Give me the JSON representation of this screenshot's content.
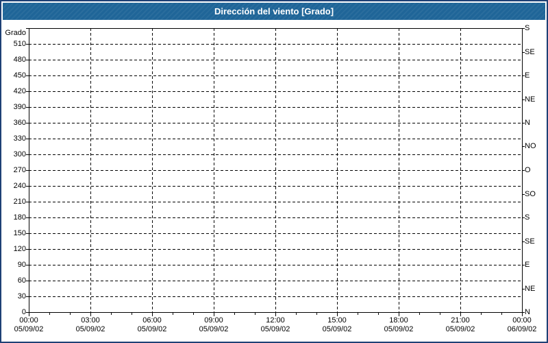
{
  "title": "Dirección del viento [Grado]",
  "colors": {
    "titlebar": "#1f6598",
    "outer_border": "#1e4175",
    "grid_line": "#000000",
    "background": "#ffffff",
    "title_text": "#ffffff",
    "label_text": "#000000"
  },
  "chart_data": {
    "type": "line",
    "title": "Dirección del viento [Grado]",
    "grid": {
      "horizontal": "dashed",
      "vertical": "dashed"
    },
    "legend": "none",
    "series": [],
    "y_axis_left": {
      "label": "Grado",
      "min": 0,
      "max": 540,
      "tick_step": 30,
      "tick_labels": [
        "0",
        "30",
        "60",
        "90",
        "120",
        "150",
        "180",
        "210",
        "240",
        "270",
        "300",
        "330",
        "360",
        "390",
        "420",
        "450",
        "480",
        "510"
      ]
    },
    "y_axis_right": {
      "tick_step": 45,
      "tick_labels_top_to_bottom": [
        "S",
        "SE",
        "E",
        "NE",
        "N",
        "NO",
        "O",
        "SO",
        "S",
        "SE",
        "E",
        "NE",
        "N"
      ]
    },
    "x_axis": {
      "minor_ticks_per_major_interval": 2,
      "major_ticks": [
        {
          "time": "00:00",
          "date": "05/09/02"
        },
        {
          "time": "03:00",
          "date": "05/09/02"
        },
        {
          "time": "06:00",
          "date": "05/09/02"
        },
        {
          "time": "09:00",
          "date": "05/09/02"
        },
        {
          "time": "12:00",
          "date": "05/09/02"
        },
        {
          "time": "15:00",
          "date": "05/09/02"
        },
        {
          "time": "18:00",
          "date": "05/09/02"
        },
        {
          "time": "21:00",
          "date": "05/09/02"
        },
        {
          "time": "00:00",
          "date": "06/09/02"
        }
      ]
    }
  }
}
